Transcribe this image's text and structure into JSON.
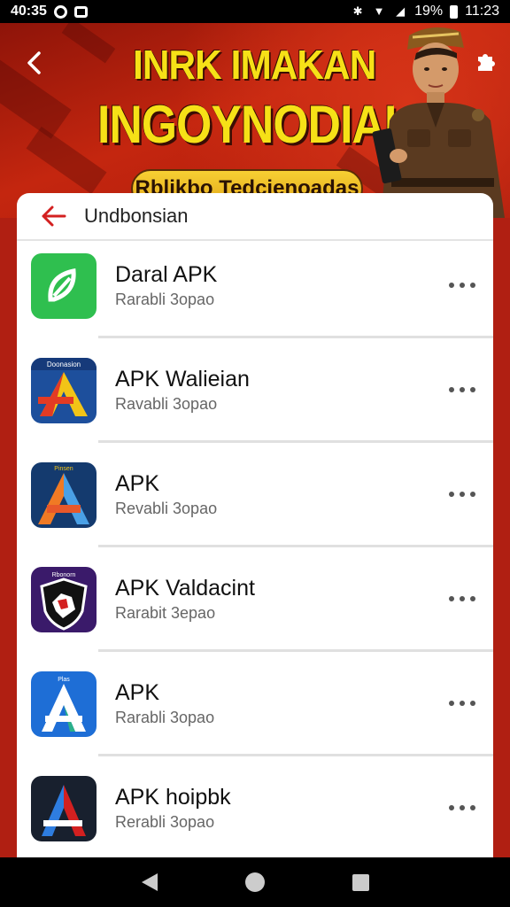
{
  "status_bar": {
    "time_left": "40:35",
    "battery": "19%",
    "time_right": "11:23"
  },
  "banner": {
    "title_line1": "INRK IMAKAN",
    "title_line2": "INGOYNODIAI",
    "pill_text": "Rblikbo Tedcienoadas",
    "colors": {
      "title": "#f6e117",
      "background": "#c4260f"
    }
  },
  "card": {
    "title": "Undbonsian"
  },
  "apps": [
    {
      "name": "Daral APK",
      "subtitle": "Rarabli 3opao",
      "icon": "green-leaf-icon"
    },
    {
      "name": "APK Walieian",
      "subtitle": "Ravabli 3opao",
      "icon": "yellow-a-icon"
    },
    {
      "name": "APK",
      "subtitle": "Revabli 3opao",
      "icon": "orange-blue-a-icon"
    },
    {
      "name": "APK Valdacint",
      "subtitle": "Rarabit 3epao",
      "icon": "purple-shield-icon"
    },
    {
      "name": "APK",
      "subtitle": "Rarabli 3opao",
      "icon": "blue-a-icon"
    },
    {
      "name": "APK hoipbk",
      "subtitle": "Rerabli 3opao",
      "icon": "dark-a-icon"
    }
  ],
  "app_icon_labels": [
    "Doonasion",
    "Pinsen",
    "Rbonorn",
    "Plas"
  ]
}
